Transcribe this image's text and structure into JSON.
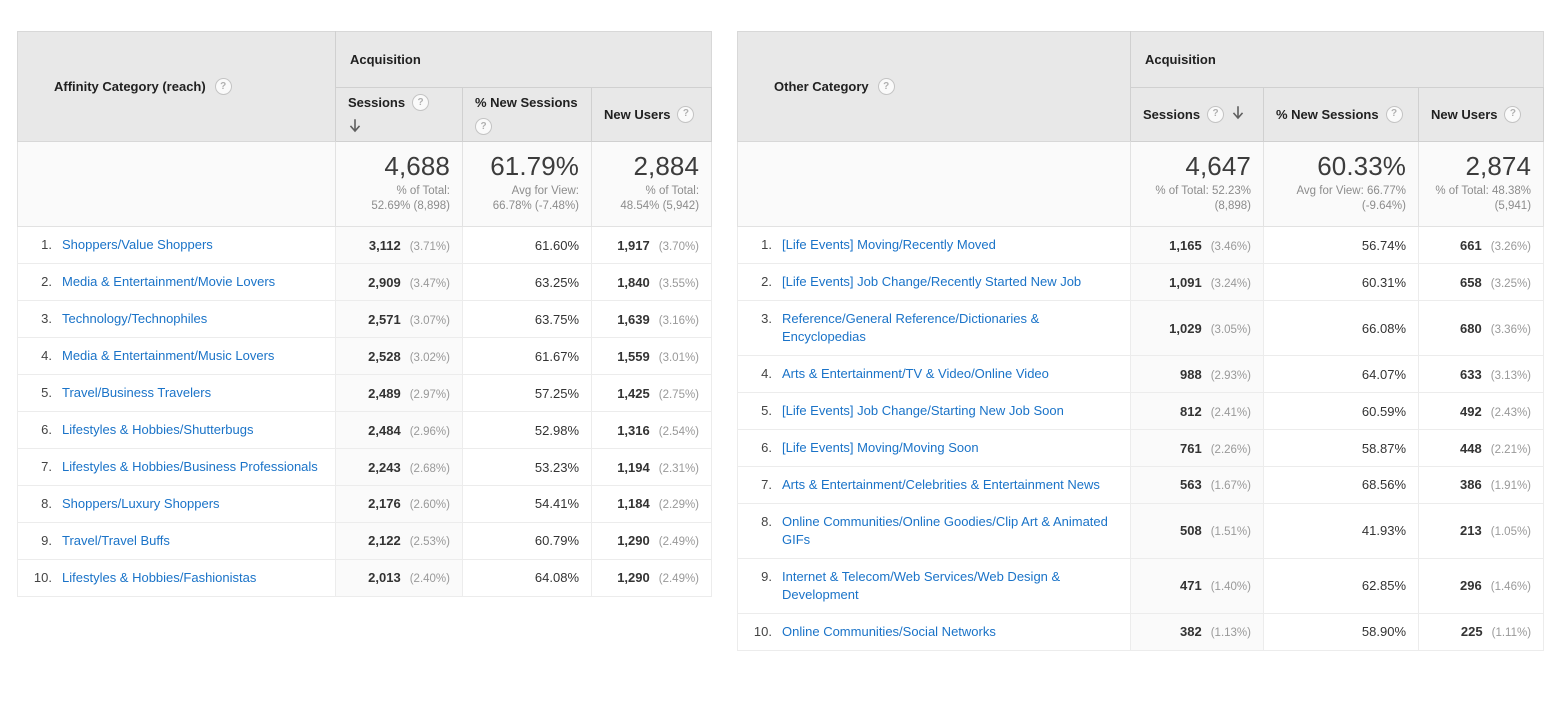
{
  "tables": [
    {
      "id": "affinity",
      "dimension_header": "Affinity Category (reach)",
      "group_header": "Acquisition",
      "metrics": [
        {
          "label": "Sessions",
          "sorted": true,
          "sort_direction": "descending"
        },
        {
          "label": "% New Sessions",
          "sorted": false
        },
        {
          "label": "New Users",
          "sorted": false
        }
      ],
      "summary": [
        {
          "value": "4,688",
          "sub_line1": "% of Total:",
          "sub_line2": "52.69% (8,898)"
        },
        {
          "value": "61.79%",
          "sub_line1": "Avg for View:",
          "sub_line2": "66.78% (-7.48%)"
        },
        {
          "value": "2,884",
          "sub_line1": "% of Total:",
          "sub_line2": "48.54% (5,942)"
        }
      ],
      "rows": [
        {
          "index": "1.",
          "name": "Shoppers/Value Shoppers",
          "sessions": "3,112",
          "sessions_pct": "(3.71%)",
          "new_sessions_pct": "61.60%",
          "new_users": "1,917",
          "new_users_pct": "(3.70%)"
        },
        {
          "index": "2.",
          "name": "Media & Entertainment/Movie Lovers",
          "sessions": "2,909",
          "sessions_pct": "(3.47%)",
          "new_sessions_pct": "63.25%",
          "new_users": "1,840",
          "new_users_pct": "(3.55%)"
        },
        {
          "index": "3.",
          "name": "Technology/Technophiles",
          "sessions": "2,571",
          "sessions_pct": "(3.07%)",
          "new_sessions_pct": "63.75%",
          "new_users": "1,639",
          "new_users_pct": "(3.16%)"
        },
        {
          "index": "4.",
          "name": "Media & Entertainment/Music Lovers",
          "sessions": "2,528",
          "sessions_pct": "(3.02%)",
          "new_sessions_pct": "61.67%",
          "new_users": "1,559",
          "new_users_pct": "(3.01%)"
        },
        {
          "index": "5.",
          "name": "Travel/Business Travelers",
          "sessions": "2,489",
          "sessions_pct": "(2.97%)",
          "new_sessions_pct": "57.25%",
          "new_users": "1,425",
          "new_users_pct": "(2.75%)"
        },
        {
          "index": "6.",
          "name": "Lifestyles & Hobbies/Shutterbugs",
          "sessions": "2,484",
          "sessions_pct": "(2.96%)",
          "new_sessions_pct": "52.98%",
          "new_users": "1,316",
          "new_users_pct": "(2.54%)"
        },
        {
          "index": "7.",
          "name": "Lifestyles & Hobbies/Business Professionals",
          "sessions": "2,243",
          "sessions_pct": "(2.68%)",
          "new_sessions_pct": "53.23%",
          "new_users": "1,194",
          "new_users_pct": "(2.31%)"
        },
        {
          "index": "8.",
          "name": "Shoppers/Luxury Shoppers",
          "sessions": "2,176",
          "sessions_pct": "(2.60%)",
          "new_sessions_pct": "54.41%",
          "new_users": "1,184",
          "new_users_pct": "(2.29%)"
        },
        {
          "index": "9.",
          "name": "Travel/Travel Buffs",
          "sessions": "2,122",
          "sessions_pct": "(2.53%)",
          "new_sessions_pct": "60.79%",
          "new_users": "1,290",
          "new_users_pct": "(2.49%)"
        },
        {
          "index": "10.",
          "name": "Lifestyles & Hobbies/Fashionistas",
          "sessions": "2,013",
          "sessions_pct": "(2.40%)",
          "new_sessions_pct": "64.08%",
          "new_users": "1,290",
          "new_users_pct": "(2.49%)"
        }
      ]
    },
    {
      "id": "other",
      "dimension_header": "Other Category",
      "group_header": "Acquisition",
      "metrics": [
        {
          "label": "Sessions",
          "sorted": true,
          "sort_direction": "descending"
        },
        {
          "label": "% New Sessions",
          "sorted": false
        },
        {
          "label": "New Users",
          "sorted": false
        }
      ],
      "summary": [
        {
          "value": "4,647",
          "sub_line1": "% of Total: 52.23%",
          "sub_line2": "(8,898)"
        },
        {
          "value": "60.33%",
          "sub_line1": "Avg for View: 66.77%",
          "sub_line2": "(-9.64%)"
        },
        {
          "value": "2,874",
          "sub_line1": "% of Total: 48.38%",
          "sub_line2": "(5,941)"
        }
      ],
      "rows": [
        {
          "index": "1.",
          "name": "[Life Events] Moving/Recently Moved",
          "sessions": "1,165",
          "sessions_pct": "(3.46%)",
          "new_sessions_pct": "56.74%",
          "new_users": "661",
          "new_users_pct": "(3.26%)"
        },
        {
          "index": "2.",
          "name": "[Life Events] Job Change/Recently Started New Job",
          "sessions": "1,091",
          "sessions_pct": "(3.24%)",
          "new_sessions_pct": "60.31%",
          "new_users": "658",
          "new_users_pct": "(3.25%)"
        },
        {
          "index": "3.",
          "name": "Reference/General Reference/Dictionaries & Encyclopedias",
          "sessions": "1,029",
          "sessions_pct": "(3.05%)",
          "new_sessions_pct": "66.08%",
          "new_users": "680",
          "new_users_pct": "(3.36%)"
        },
        {
          "index": "4.",
          "name": "Arts & Entertainment/TV & Video/Online Video",
          "sessions": "988",
          "sessions_pct": "(2.93%)",
          "new_sessions_pct": "64.07%",
          "new_users": "633",
          "new_users_pct": "(3.13%)"
        },
        {
          "index": "5.",
          "name": "[Life Events] Job Change/Starting New Job Soon",
          "sessions": "812",
          "sessions_pct": "(2.41%)",
          "new_sessions_pct": "60.59%",
          "new_users": "492",
          "new_users_pct": "(2.43%)"
        },
        {
          "index": "6.",
          "name": "[Life Events] Moving/Moving Soon",
          "sessions": "761",
          "sessions_pct": "(2.26%)",
          "new_sessions_pct": "58.87%",
          "new_users": "448",
          "new_users_pct": "(2.21%)"
        },
        {
          "index": "7.",
          "name": "Arts & Entertainment/Celebrities & Entertainment News",
          "sessions": "563",
          "sessions_pct": "(1.67%)",
          "new_sessions_pct": "68.56%",
          "new_users": "386",
          "new_users_pct": "(1.91%)"
        },
        {
          "index": "8.",
          "name": "Online Communities/Online Goodies/Clip Art & Animated GIFs",
          "sessions": "508",
          "sessions_pct": "(1.51%)",
          "new_sessions_pct": "41.93%",
          "new_users": "213",
          "new_users_pct": "(1.05%)"
        },
        {
          "index": "9.",
          "name": "Internet & Telecom/Web Services/Web Design & Development",
          "sessions": "471",
          "sessions_pct": "(1.40%)",
          "new_sessions_pct": "62.85%",
          "new_users": "296",
          "new_users_pct": "(1.46%)"
        },
        {
          "index": "10.",
          "name": "Online Communities/Social Networks",
          "sessions": "382",
          "sessions_pct": "(1.13%)",
          "new_sessions_pct": "58.90%",
          "new_users": "225",
          "new_users_pct": "(1.11%)"
        }
      ]
    }
  ],
  "icons": {
    "help": "?",
    "sort_desc": "sort-descending-arrow"
  },
  "colors": {
    "link": "#1a73c8",
    "header_bg": "#e8e8e8",
    "summary_bg": "#fafafa",
    "muted_text": "#999999"
  }
}
